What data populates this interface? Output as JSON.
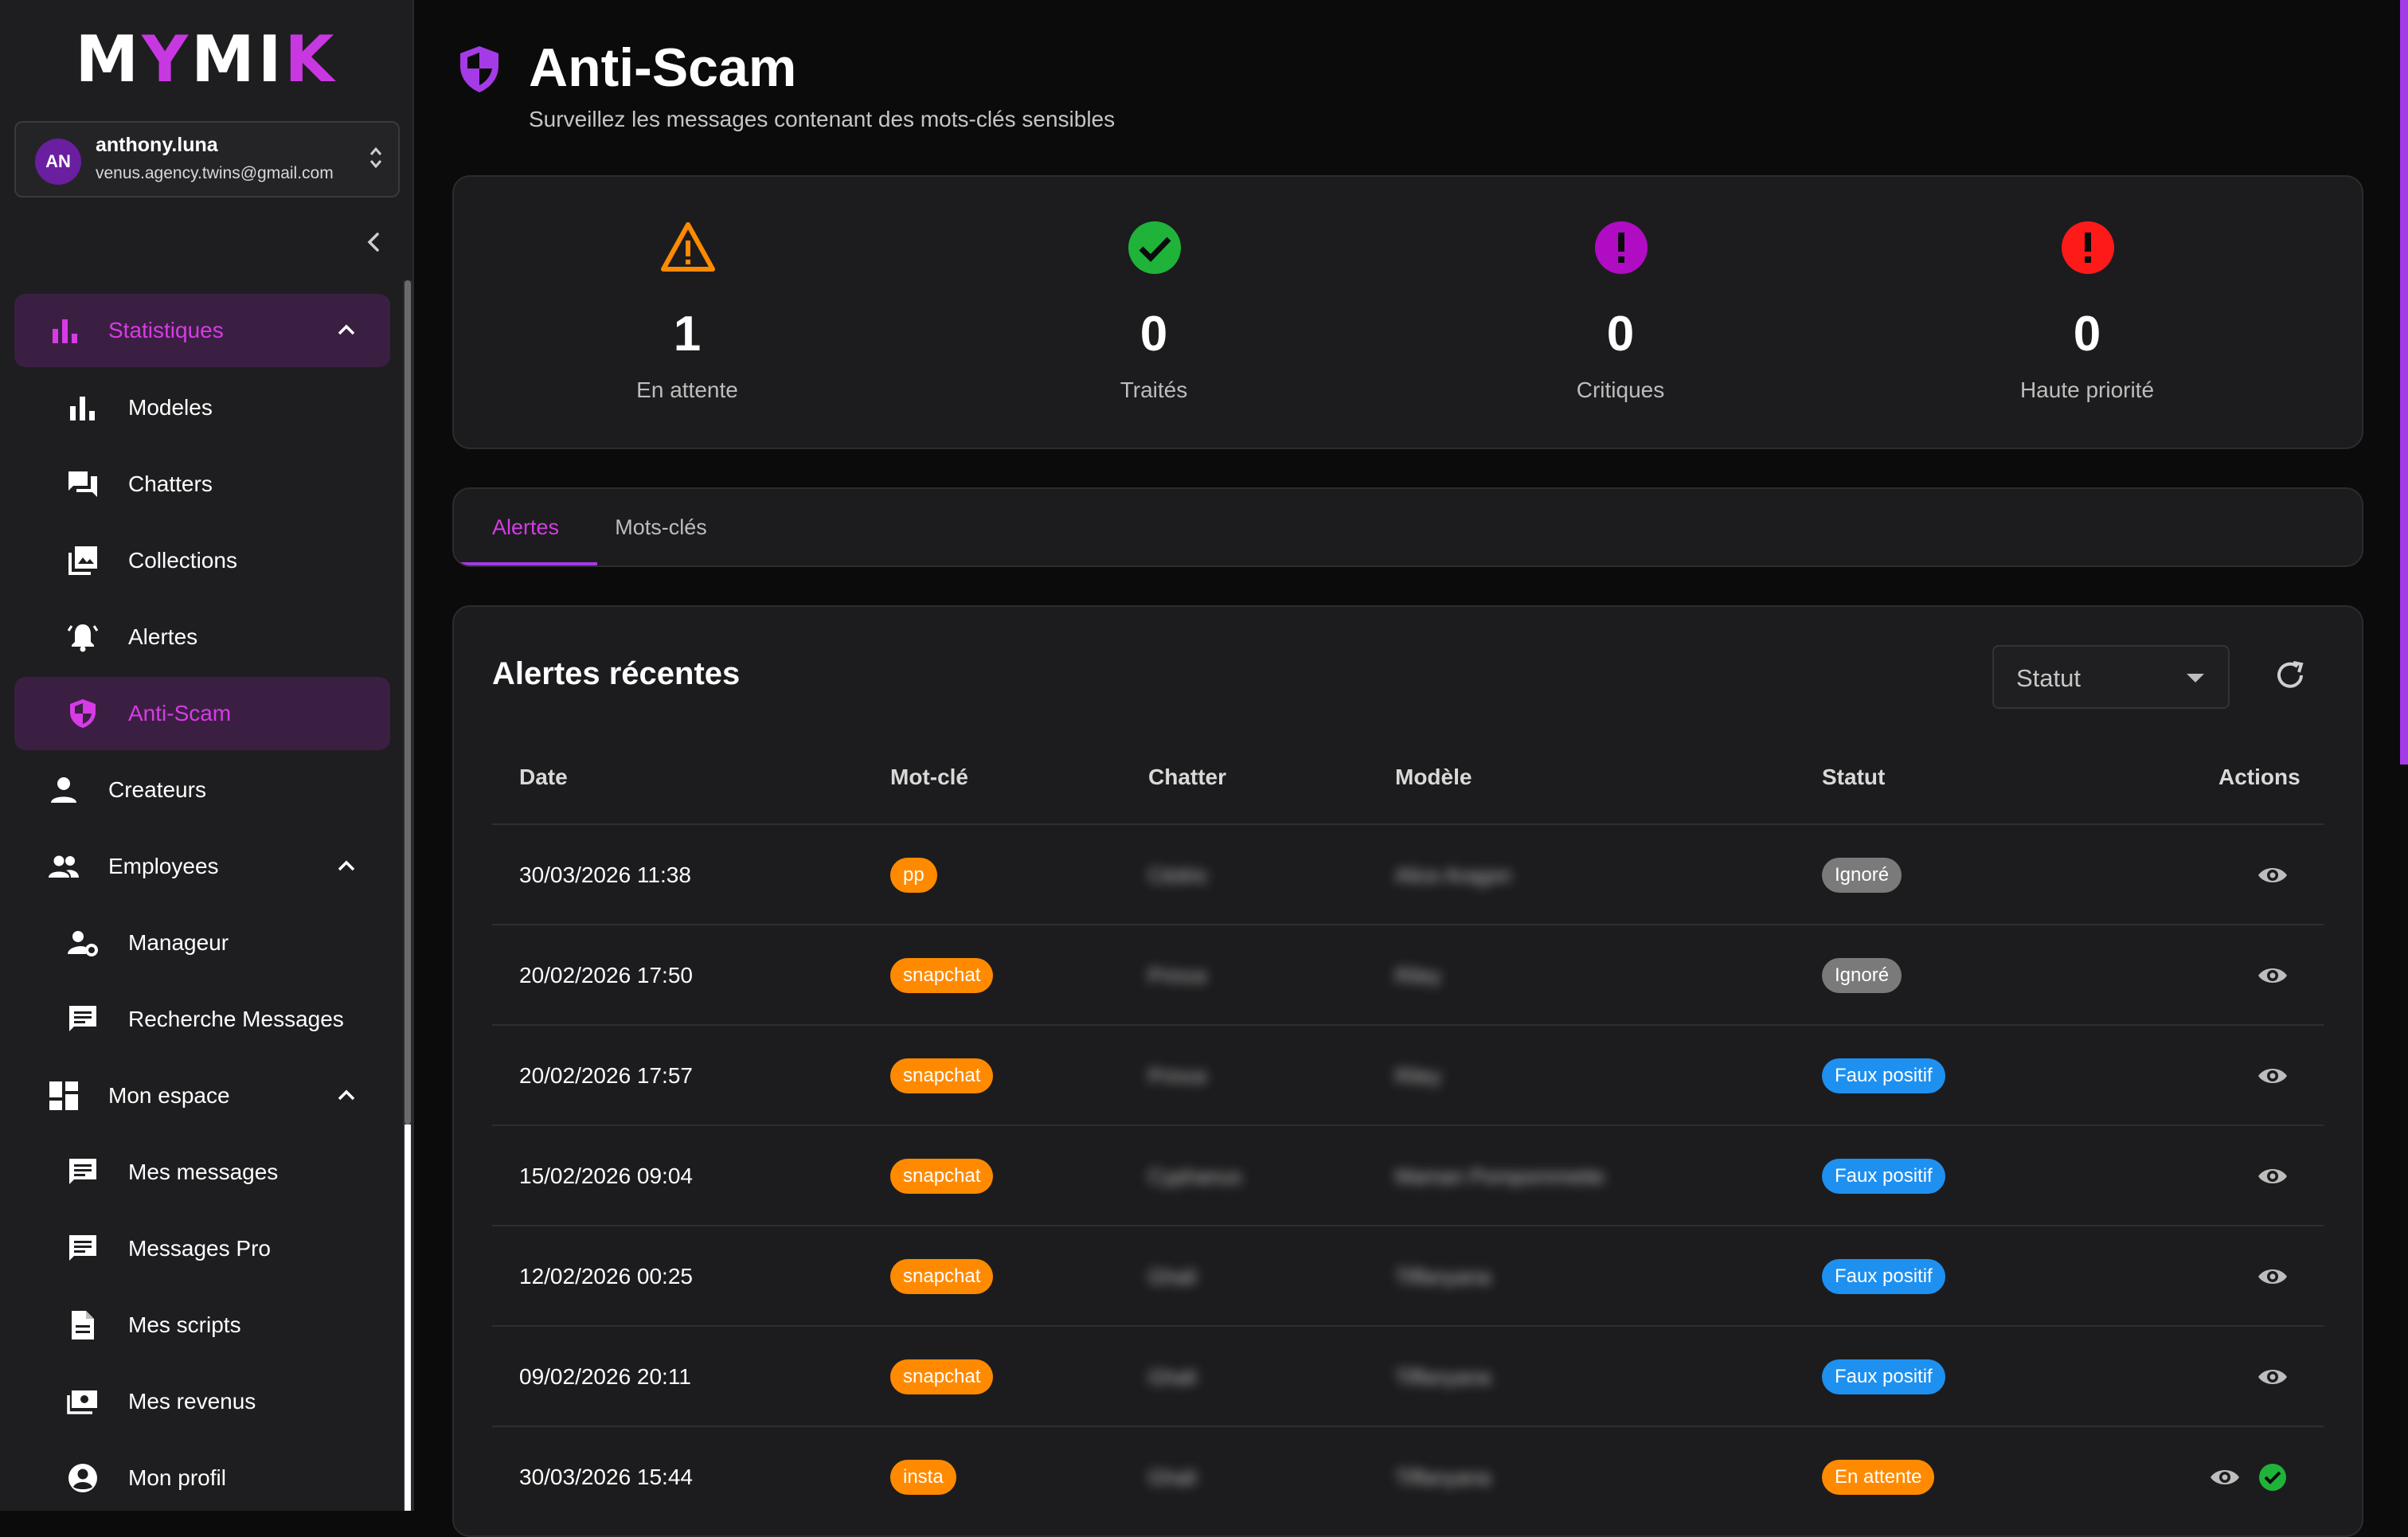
{
  "app": {
    "logo_parts": [
      "M",
      "Y",
      "MI",
      "K"
    ]
  },
  "user": {
    "initials": "AN",
    "name": "anthony.luna",
    "email": "venus.agency.twins@gmail.com"
  },
  "sidebar": {
    "items": [
      {
        "label": "Statistiques",
        "icon": "bar-chart-icon"
      },
      {
        "label": "Modeles",
        "icon": "bar-chart-icon"
      },
      {
        "label": "Chatters",
        "icon": "forum-icon"
      },
      {
        "label": "Collections",
        "icon": "photo-library-icon"
      },
      {
        "label": "Alertes",
        "icon": "bell-ring-icon"
      },
      {
        "label": "Anti-Scam",
        "icon": "shield-icon"
      },
      {
        "label": "Createurs",
        "icon": "person-icon"
      },
      {
        "label": "Employees",
        "icon": "people-icon"
      },
      {
        "label": "Manageur",
        "icon": "manager-gear-icon"
      },
      {
        "label": "Recherche Messages",
        "icon": "message-icon"
      },
      {
        "label": "Mon espace",
        "icon": "dashboard-icon"
      },
      {
        "label": "Mes messages",
        "icon": "message-icon"
      },
      {
        "label": "Messages Pro",
        "icon": "message-icon"
      },
      {
        "label": "Mes scripts",
        "icon": "document-icon"
      },
      {
        "label": "Mes revenus",
        "icon": "money-icon"
      },
      {
        "label": "Mon profil",
        "icon": "account-circle-icon"
      }
    ]
  },
  "page": {
    "title": "Anti-Scam",
    "subtitle": "Surveillez les messages contenant des mots-clés sensibles"
  },
  "stats": [
    {
      "value": "1",
      "label": "En attente",
      "icon": "warning-triangle-icon",
      "color": "#ff8a00"
    },
    {
      "value": "0",
      "label": "Traités",
      "icon": "check-circle-icon",
      "color": "#1fb33a"
    },
    {
      "value": "0",
      "label": "Critiques",
      "icon": "exclamation-circle-icon",
      "color": "#b00cc4"
    },
    {
      "value": "0",
      "label": "Haute priorité",
      "icon": "exclamation-circle-icon",
      "color": "#ff1a1a"
    }
  ],
  "tabs": [
    {
      "label": "Alertes"
    },
    {
      "label": "Mots-clés"
    }
  ],
  "alerts": {
    "title": "Alertes récentes",
    "status_filter": "Statut",
    "columns": {
      "date": "Date",
      "keyword": "Mot-clé",
      "chatter": "Chatter",
      "model": "Modèle",
      "status": "Statut",
      "actions": "Actions"
    },
    "rows": [
      {
        "date": "30/03/2026 11:38",
        "keyword": "pp",
        "chatter": "Cédric",
        "model": "Alice Aragon",
        "status": "Ignoré",
        "status_color": "#7a7a7a"
      },
      {
        "date": "20/02/2026 17:50",
        "keyword": "snapchat",
        "chatter": "Prince",
        "model": "Riley",
        "status": "Ignoré",
        "status_color": "#7a7a7a"
      },
      {
        "date": "20/02/2026 17:57",
        "keyword": "snapchat",
        "chatter": "Prince",
        "model": "Riley",
        "status": "Faux positif",
        "status_color": "#1e90f0"
      },
      {
        "date": "15/02/2026 09:04",
        "keyword": "snapchat",
        "chatter": "Cyphanus",
        "model": "Maman Pompommette",
        "status": "Faux positif",
        "status_color": "#1e90f0"
      },
      {
        "date": "12/02/2026 00:25",
        "keyword": "snapchat",
        "chatter": "Ghali",
        "model": "Tiffanyana",
        "status": "Faux positif",
        "status_color": "#1e90f0"
      },
      {
        "date": "09/02/2026 20:11",
        "keyword": "snapchat",
        "chatter": "Ghali",
        "model": "Tiffanyana",
        "status": "Faux positif",
        "status_color": "#1e90f0"
      },
      {
        "date": "30/03/2026 15:44",
        "keyword": "insta",
        "chatter": "Ghali",
        "model": "Tiffanyana",
        "status": "En attente",
        "status_color": "#ff8a00"
      }
    ]
  },
  "colors": {
    "accent": "#d63be6",
    "keyword_pill": "#ff8a00"
  }
}
